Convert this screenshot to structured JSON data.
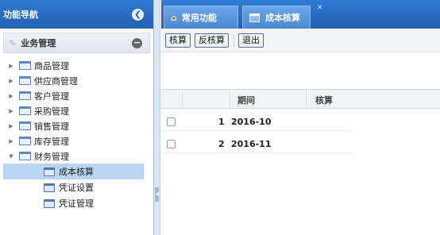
{
  "sidebar": {
    "title": "功能导航",
    "section_label": "业务管理",
    "items": [
      {
        "label": "商品管理",
        "expanded": false
      },
      {
        "label": "供应商管理",
        "expanded": false
      },
      {
        "label": "客户管理",
        "expanded": false
      },
      {
        "label": "采购管理",
        "expanded": false
      },
      {
        "label": "销售管理",
        "expanded": false
      },
      {
        "label": "库存管理",
        "expanded": false
      },
      {
        "label": "财务管理",
        "expanded": true
      }
    ],
    "children": [
      {
        "label": "成本核算",
        "selected": true
      },
      {
        "label": "凭证设置",
        "selected": false
      },
      {
        "label": "凭证管理",
        "selected": false
      }
    ]
  },
  "tabs": [
    {
      "label": "常用功能",
      "icon": "home-icon"
    },
    {
      "label": "成本核算",
      "icon": "document-icon",
      "active": true
    }
  ],
  "toolbar": {
    "calc_label": "核算",
    "reverse_label": "反核算",
    "exit_label": "退出"
  },
  "grid": {
    "columns": [
      "期间",
      "核算"
    ],
    "rows": [
      {
        "num": "1",
        "period": "2016-10"
      },
      {
        "num": "2",
        "period": "2016-11"
      }
    ]
  },
  "colors": {
    "header_blue": "#2160ae",
    "tab_blue": "#4a88d2",
    "selected_row": "#b9d6f4"
  }
}
